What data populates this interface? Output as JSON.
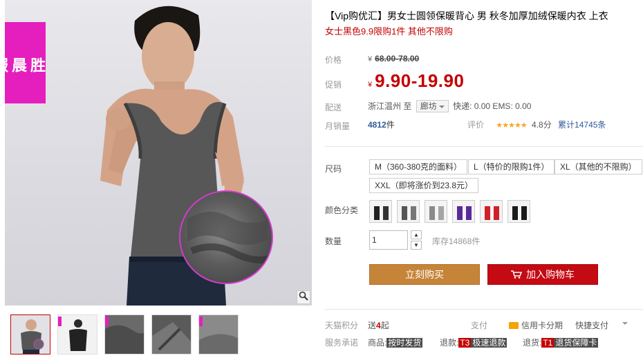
{
  "gallery": {
    "brand_chars": [
      "胜",
      "晨",
      "服",
      "饰"
    ],
    "zoom_icon": "magnifier-icon",
    "thumbnails": [
      {
        "name": "thumb-model-front",
        "active": true
      },
      {
        "name": "thumb-model-back",
        "active": false
      },
      {
        "name": "thumb-fleece-detail",
        "active": false
      },
      {
        "name": "thumb-fabric-fold",
        "active": false
      },
      {
        "name": "thumb-fabric-texture",
        "active": false
      }
    ]
  },
  "product": {
    "title": "【Vip购优汇】男女士圆领保暖背心 男 秋冬加厚加绒保暖内衣 上衣",
    "subtitle": "女士黑色9.9限购1件 其他不限购"
  },
  "price": {
    "label": "价格",
    "currency": "¥",
    "original": "68.00-78.00",
    "promo_label": "促销",
    "promo": "9.90-19.90"
  },
  "shipping": {
    "label": "配送",
    "from": "浙江温州",
    "to_word": "至",
    "destination": "廊坊",
    "fees": "快递: 0.00 EMS: 0.00"
  },
  "sales": {
    "label": "月销量",
    "count": "4812",
    "unit": "件",
    "rating_label": "评价",
    "stars": "★★★★★",
    "score": "4.8分",
    "cumulative": "累计14745条"
  },
  "sku": {
    "size_label": "尺码",
    "sizes": [
      "M（360-380克的面料）",
      "L（特价的限购1件）",
      "XL（其他的不限购）",
      "XXL（即将涨价到23.8元）"
    ],
    "color_label": "颜色分类",
    "colors": [
      {
        "name": "black-pair",
        "c1": "#222",
        "c2": "#333"
      },
      {
        "name": "grey-pair",
        "c1": "#555",
        "c2": "#777"
      },
      {
        "name": "light-grey-pair",
        "c1": "#8a8a8a",
        "c2": "#a5a5a5"
      },
      {
        "name": "purple",
        "c1": "#5a2a9a",
        "c2": "#5a2a9a"
      },
      {
        "name": "red",
        "c1": "#d0202a",
        "c2": "#d0202a"
      },
      {
        "name": "black-women",
        "c1": "#1a1a1a",
        "c2": "#1a1a1a"
      }
    ]
  },
  "quantity": {
    "label": "数量",
    "value": "1",
    "up": "▲",
    "down": "▼",
    "stock": "库存14868件"
  },
  "actions": {
    "buy_now": "立刻购买",
    "add_cart": "加入购物车"
  },
  "footer": {
    "points_label": "天猫积分",
    "points_prefix": "送",
    "points_value": "4",
    "points_suffix": "起",
    "pay_label": "支付",
    "credit": "信用卡分期",
    "quick_pay": "快捷支付",
    "promise_label": "服务承诺",
    "goods_label": "商品:",
    "goods_tag": "按时发货",
    "refund_label": "退款:",
    "refund_code": "T3",
    "refund_tag": "极速退款",
    "return_label": "退货:",
    "return_code": "T1",
    "return_tag": "退货保障卡"
  },
  "colors": {
    "brand_magenta": "#e41fbe",
    "price_red": "#c40000",
    "buy_orange": "#c68439",
    "cart_red": "#c40a13"
  }
}
